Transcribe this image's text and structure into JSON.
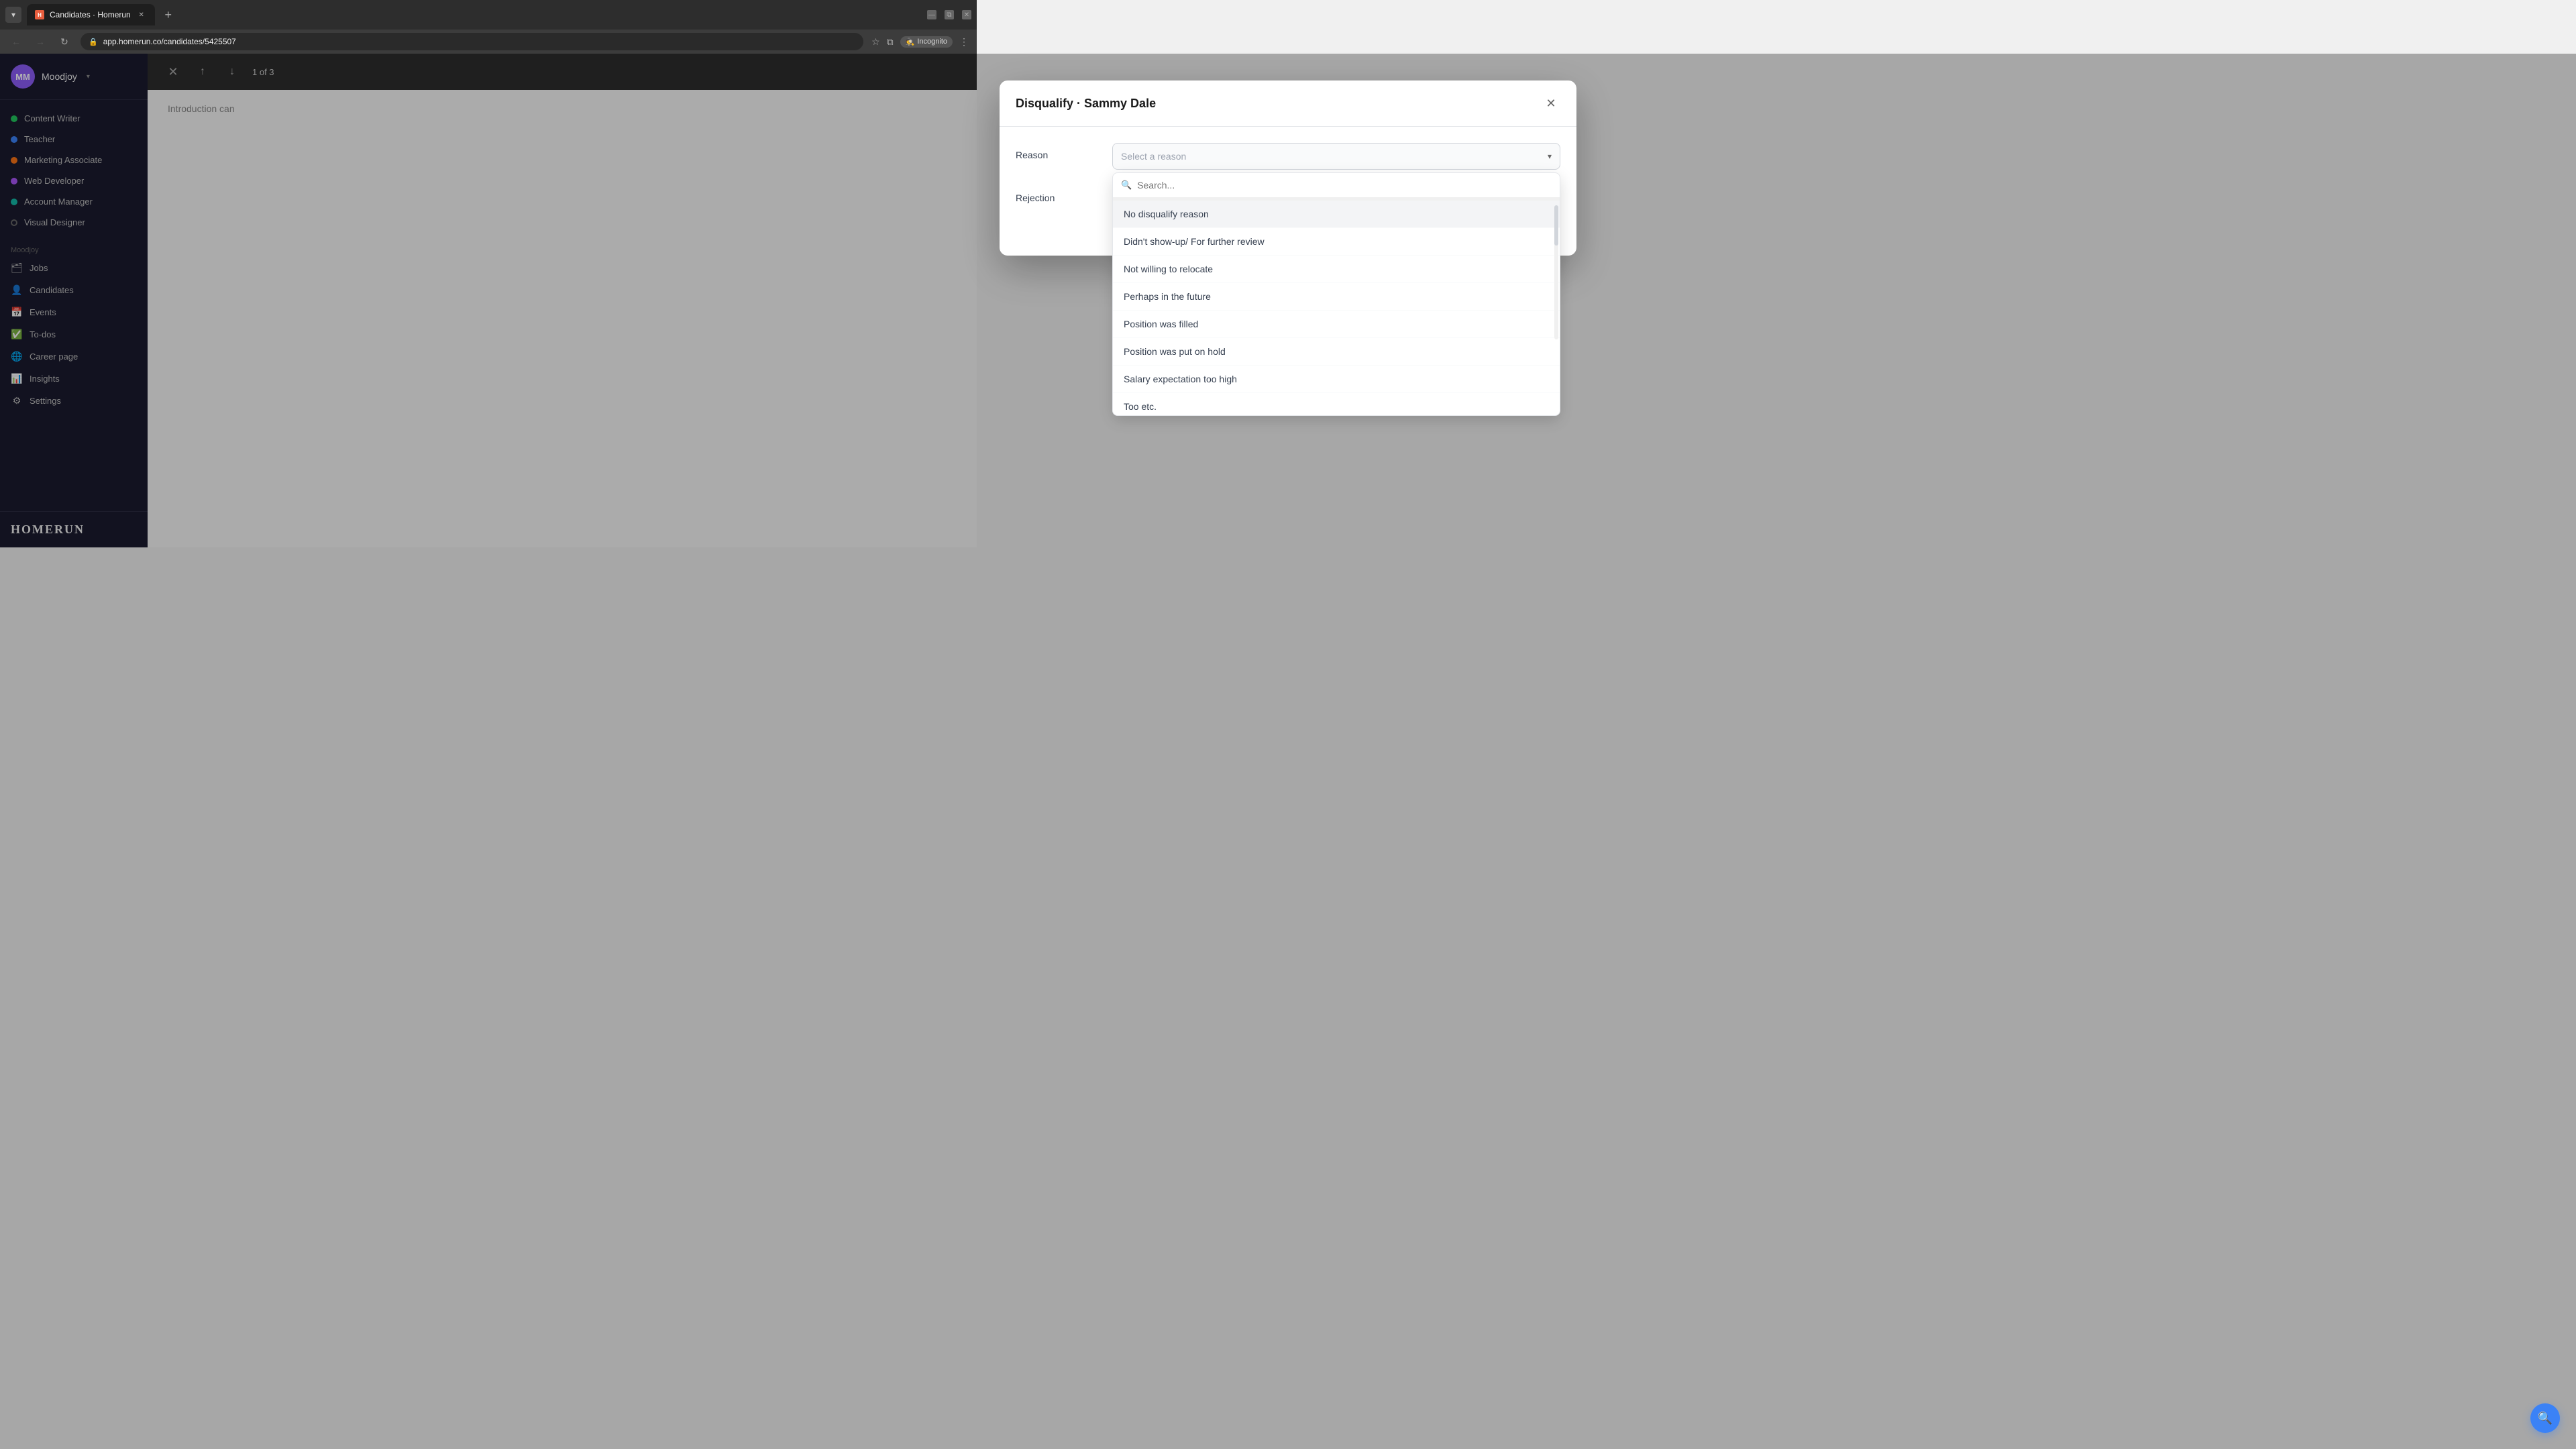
{
  "browser": {
    "tab_title": "Candidates · Homerun",
    "url": "app.homerun.co/candidates/5425507",
    "tab_favicon": "H",
    "incognito_label": "Incognito"
  },
  "sidebar": {
    "user_initials": "MM",
    "user_name": "Moodjoy",
    "jobs": [
      {
        "id": 1,
        "label": "Content Writer",
        "dot_color": "dot-green"
      },
      {
        "id": 2,
        "label": "Teacher",
        "dot_color": "dot-blue"
      },
      {
        "id": 3,
        "label": "Marketing Associate",
        "dot_color": "dot-orange"
      },
      {
        "id": 4,
        "label": "Web Developer",
        "dot_color": "dot-purple"
      },
      {
        "id": 5,
        "label": "Account Manager",
        "dot_color": "dot-teal"
      },
      {
        "id": 6,
        "label": "Visual Designer",
        "dot_color": "dot-gray"
      }
    ],
    "section_label": "Moodjoy",
    "nav_items": [
      {
        "id": "jobs",
        "label": "Jobs",
        "icon": "🗂"
      },
      {
        "id": "candidates",
        "label": "Candidates",
        "icon": "👤"
      },
      {
        "id": "events",
        "label": "Events",
        "icon": "📅"
      },
      {
        "id": "todos",
        "label": "To-dos",
        "icon": "✅"
      },
      {
        "id": "career",
        "label": "Career page",
        "icon": "🌐"
      },
      {
        "id": "insights",
        "label": "Insights",
        "icon": "📊"
      },
      {
        "id": "settings",
        "label": "Settings",
        "icon": "⚙"
      }
    ],
    "logo_text": "HOMERUN"
  },
  "candidate_nav": {
    "counter": "1 of 3"
  },
  "modal": {
    "title": "Disqualify · Sammy Dale",
    "reason_label": "Reason",
    "rejection_label": "Rejection",
    "select_placeholder": "Select a reason",
    "search_placeholder": "Search...",
    "dropdown_items": [
      {
        "id": 1,
        "label": "No disqualify reason",
        "highlighted": true
      },
      {
        "id": 2,
        "label": "Didn't show-up/ For further review"
      },
      {
        "id": 3,
        "label": "Not willing to relocate"
      },
      {
        "id": 4,
        "label": "Perhaps in the future"
      },
      {
        "id": 5,
        "label": "Position was filled"
      },
      {
        "id": 6,
        "label": "Position was put on hold"
      },
      {
        "id": 7,
        "label": "Salary expectation too high"
      },
      {
        "id": 8,
        "label": "Too etc."
      }
    ]
  },
  "background": {
    "intro_text": "Introduction can"
  },
  "support_btn": "🔍"
}
